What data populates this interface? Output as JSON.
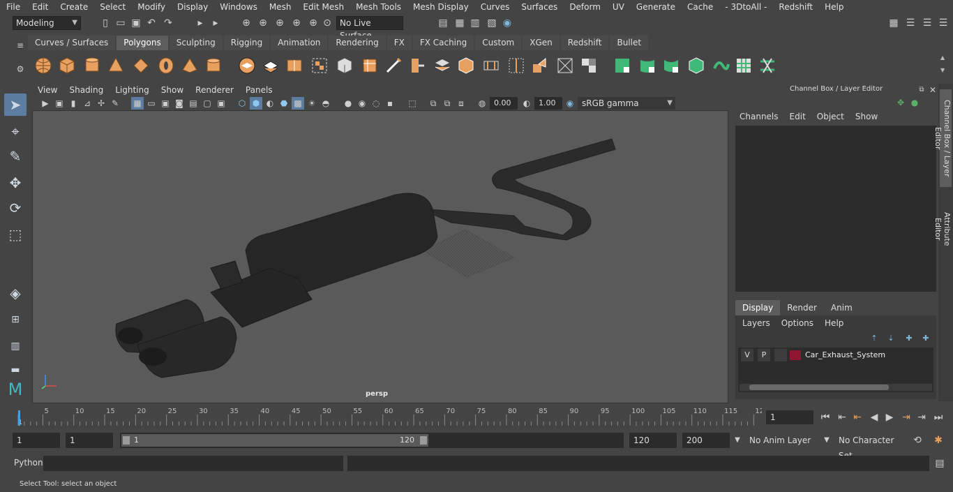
{
  "menubar": {
    "items": [
      "File",
      "Edit",
      "Create",
      "Select",
      "Modify",
      "Display",
      "Windows",
      "Mesh",
      "Edit Mesh",
      "Mesh Tools",
      "Mesh Display",
      "Curves",
      "Surfaces",
      "Deform",
      "UV",
      "Generate",
      "Cache",
      "- 3DtoAll -",
      "Redshift",
      "Help"
    ]
  },
  "statusline": {
    "mode": "Modeling",
    "live_surface": "No Live Surface"
  },
  "shelf": {
    "tabs": [
      "Curves / Surfaces",
      "Polygons",
      "Sculpting",
      "Rigging",
      "Animation",
      "Rendering",
      "FX",
      "FX Caching",
      "Custom",
      "XGen",
      "Redshift",
      "Bullet"
    ],
    "active_tab": "Polygons"
  },
  "viewport": {
    "menu": [
      "View",
      "Shading",
      "Lighting",
      "Show",
      "Renderer",
      "Panels"
    ],
    "exposure": "0.00",
    "gamma": "1.00",
    "color_space": "sRGB gamma",
    "camera_label": "persp"
  },
  "channel_box": {
    "title": "Channel Box / Layer Editor",
    "menu": [
      "Channels",
      "Edit",
      "Object",
      "Show"
    ],
    "tabs": [
      "Display",
      "Render",
      "Anim"
    ],
    "active_tab": "Display",
    "layer_menu": [
      "Layers",
      "Options",
      "Help"
    ],
    "layers": [
      {
        "v": "V",
        "p": "P",
        "name": "Car_Exhaust_System",
        "color": "#8e1732"
      }
    ],
    "side_tabs": [
      "Channel Box / Layer Editor",
      "Attribute Editor"
    ]
  },
  "timeline": {
    "ticks": [
      "1",
      "5",
      "10",
      "15",
      "20",
      "25",
      "30",
      "35",
      "40",
      "45",
      "50",
      "55",
      "60",
      "65",
      "70",
      "75",
      "80",
      "85",
      "90",
      "95",
      "100",
      "105",
      "110",
      "115",
      "12"
    ],
    "current_frame": "1"
  },
  "range": {
    "start": "1",
    "start_inner": "1",
    "slider_start": "1",
    "slider_end": "120",
    "end_inner": "120",
    "end": "200",
    "anim_layer": "No Anim Layer",
    "character_set": "No Character Set"
  },
  "command": {
    "language": "Python"
  },
  "help": {
    "text": "Select Tool: select an object"
  },
  "colors": {
    "accent": "#5285a6",
    "layer": "#8e1732"
  }
}
